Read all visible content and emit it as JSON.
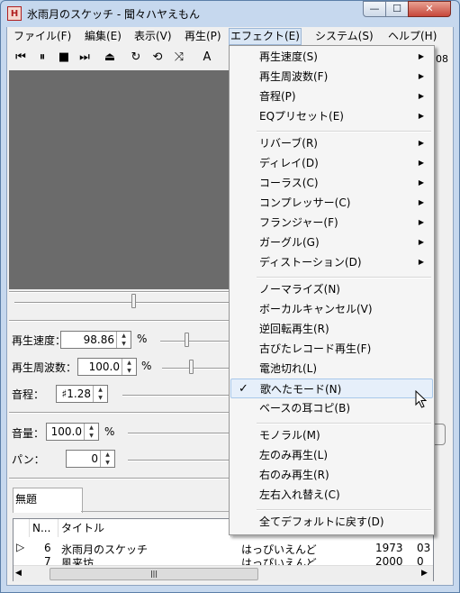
{
  "window": {
    "title": "氷雨月のスケッチ - 聞々ハヤえもん",
    "app_icon": "H",
    "controls": {
      "minimize": "—",
      "maximize": "☐",
      "close": "✕"
    }
  },
  "menubar": [
    "ファイル(F)",
    "編集(E)",
    "表示(V)",
    "再生(P)",
    "エフェクト(E)",
    "システム(S)",
    "ヘルプ(H)"
  ],
  "toolbar": {
    "icons": [
      "skip-back-icon",
      "pause-icon",
      "stop-icon",
      "skip-forward-icon",
      "eject-icon",
      "loop-single-icon",
      "loop-all-icon",
      "random-icon",
      "text-a-icon"
    ],
    "glyphs": [
      "⏮",
      "⏸",
      "■",
      "⏭",
      "⏏",
      "↻",
      "⟲",
      "⤨",
      "A"
    ],
    "time_fragment": "08"
  },
  "controls": {
    "speed_label": "再生速度：",
    "speed_value": "98.86",
    "speed_unit": "%",
    "freq_label": "再生周波数：",
    "freq_value": "100.0",
    "freq_unit": "%",
    "pitch_label": "音程：",
    "pitch_value": "♯1.28",
    "volume_label": "音量：",
    "volume_value": "100.0",
    "volume_unit": "%",
    "pan_label": "パン：",
    "pan_value": "0"
  },
  "tab": {
    "label": "無題"
  },
  "playlist": {
    "columns": [
      "N...",
      "タイトル"
    ],
    "rows": [
      {
        "marker": "▷",
        "no": "6",
        "title": "氷雨月のスケッチ",
        "artist": "はっぴいえんど",
        "year": "1973",
        "extra": "03"
      },
      {
        "marker": "",
        "no": "7",
        "title": "風来坊",
        "artist": "はっぴいえんど",
        "year": "2000",
        "extra": "0"
      }
    ]
  },
  "effect_menu": {
    "items": [
      {
        "label": "再生速度(S)",
        "submenu": true
      },
      {
        "label": "再生周波数(F)",
        "submenu": true
      },
      {
        "label": "音程(P)",
        "submenu": true
      },
      {
        "label": "EQプリセット(E)",
        "submenu": true
      },
      {
        "label": "リバーブ(R)",
        "submenu": true
      },
      {
        "label": "ディレイ(D)",
        "submenu": true
      },
      {
        "label": "コーラス(C)",
        "submenu": true
      },
      {
        "label": "コンプレッサー(C)",
        "submenu": true
      },
      {
        "label": "フランジャー(F)",
        "submenu": true
      },
      {
        "label": "ガーグル(G)",
        "submenu": true
      },
      {
        "label": "ディストーション(D)",
        "submenu": true
      },
      {
        "label": "ノーマライズ(N)",
        "submenu": false
      },
      {
        "label": "ボーカルキャンセル(V)",
        "submenu": false
      },
      {
        "label": "逆回転再生(R)",
        "submenu": false
      },
      {
        "label": "古びたレコード再生(F)",
        "submenu": false
      },
      {
        "label": "電池切れ(L)",
        "submenu": false
      },
      {
        "label": "歌へたモード(N)",
        "submenu": false,
        "checked": true,
        "highlighted": true
      },
      {
        "label": "ベースの耳コピ(B)",
        "submenu": false
      },
      {
        "label": "モノラル(M)",
        "submenu": false
      },
      {
        "label": "左のみ再生(L)",
        "submenu": false
      },
      {
        "label": "右のみ再生(R)",
        "submenu": false
      },
      {
        "label": "左右入れ替え(C)",
        "submenu": false
      },
      {
        "label": "全てデフォルトに戻す(D)",
        "submenu": false
      }
    ],
    "check_glyph": "✓",
    "arrow_glyph": "▶"
  },
  "colors": {
    "video_bg": "#6b6b6b",
    "menu_highlight": "#e6effa",
    "frame": "#c6d8ee"
  }
}
